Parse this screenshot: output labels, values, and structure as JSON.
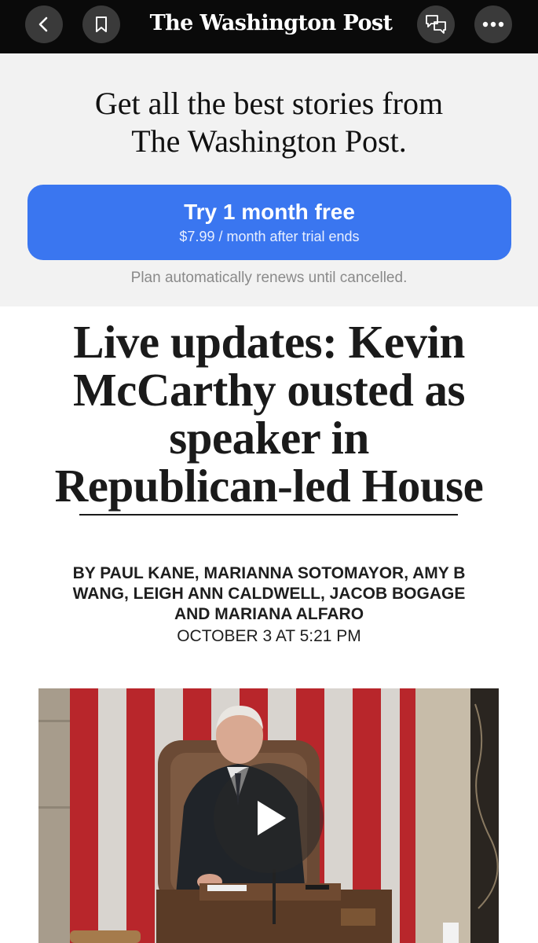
{
  "toolbar": {
    "masthead": "The Washington Post",
    "back_icon": "chevron-left-icon",
    "bookmark_icon": "bookmark-icon",
    "comments_icon": "comments-icon",
    "more_icon": "more-horizontal-icon"
  },
  "promo": {
    "headline_line1": "Get all the best stories from",
    "headline_line2": "The Washington Post.",
    "cta_label": "Try 1 month free",
    "cta_sublabel": "$7.99 / month after trial ends",
    "renew_note": "Plan automatically renews until cancelled.",
    "accent_color": "#3a76f0"
  },
  "article": {
    "headline_line1": "Live updates: Kevin",
    "headline_line2": "McCarthy ousted as",
    "headline_line3": "speaker in",
    "headline_line4": "Republican-led House",
    "byline_line1": "BY PAUL KANE, MARIANNA SOTOMAYOR, AMY B",
    "byline_line2": "WANG, LEIGH ANN CALDWELL, JACOB BOGAGE",
    "byline_line3": "AND MARIANA ALFARO",
    "dateline": "OCTOBER 3 AT 5:21 PM"
  },
  "video": {
    "play_icon": "play-icon"
  }
}
